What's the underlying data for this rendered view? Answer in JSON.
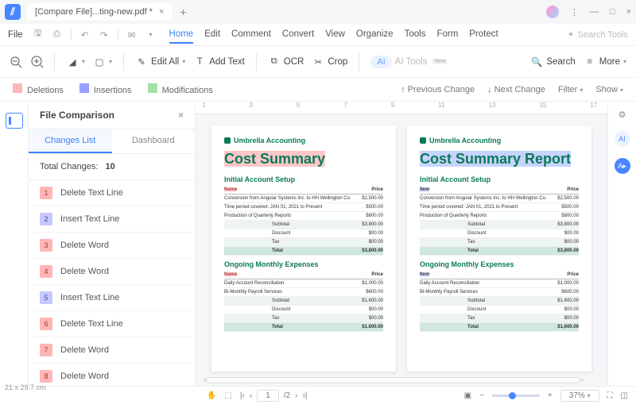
{
  "title": {
    "tab": "[Compare  File]...ting-new.pdf *"
  },
  "menu": {
    "file": "File",
    "tabs": [
      "Home",
      "Edit",
      "Comment",
      "Convert",
      "View",
      "Organize",
      "Tools",
      "Form",
      "Protect"
    ],
    "search_tools": "Search Tools"
  },
  "toolbar": {
    "edit_all": "Edit All",
    "add_text": "Add Text",
    "ocr": "OCR",
    "crop": "Crop",
    "ai_tools": "AI Tools",
    "new": "New",
    "search": "Search",
    "more": "More"
  },
  "legend": {
    "deletions": "Deletions",
    "insertions": "Insertions",
    "modifications": "Modifications",
    "prev": "Previous Change",
    "next": "Next Change",
    "filter": "Filter",
    "show": "Show"
  },
  "sidebar": {
    "title": "File Comparison",
    "tab_changes": "Changes List",
    "tab_dashboard": "Dashboard",
    "total_label": "Total Changes:",
    "total": "10",
    "items": [
      {
        "n": "1",
        "label": "Delete Text Line",
        "kind": "del"
      },
      {
        "n": "2",
        "label": "Insert Text Line",
        "kind": "ins"
      },
      {
        "n": "3",
        "label": "Delete Word",
        "kind": "del"
      },
      {
        "n": "4",
        "label": "Delete Word",
        "kind": "del"
      },
      {
        "n": "5",
        "label": "Insert Text Line",
        "kind": "ins"
      },
      {
        "n": "6",
        "label": "Delete Text Line",
        "kind": "del"
      },
      {
        "n": "7",
        "label": "Delete Word",
        "kind": "del"
      },
      {
        "n": "8",
        "label": "Delete Word",
        "kind": "del"
      }
    ]
  },
  "doc": {
    "brand": "Umbrella Accounting",
    "left_title": "Cost Summary",
    "right_title": "Cost Summary Report",
    "sec1": "Initial Account Setup",
    "sec2": "Ongoing Monthly Expenses",
    "col_name": "Name",
    "col_item": "Item",
    "col_price": "Price",
    "rows1": [
      {
        "d": "Conversion from Angular Systems Inc. to HH Wellington Co.",
        "p": "$2,500.00"
      },
      {
        "d": "Time period covered: JAN 01, 2021 to Present",
        "p": "$500.00"
      },
      {
        "d": "Production of Quarterly Reports",
        "p": "$800.00"
      }
    ],
    "sub1": [
      {
        "l": "Subtotal",
        "p": "$3,800.00"
      },
      {
        "l": "Discount",
        "p": "$00.00"
      },
      {
        "l": "Tax",
        "p": "$00.00"
      },
      {
        "l": "Total",
        "p": "$3,800.00"
      }
    ],
    "rows2": [
      {
        "d": "Daily Account Reconciliation",
        "p": "$1,000.00"
      },
      {
        "d": "Bi-Monthly Payroll Services",
        "p": "$600.00"
      }
    ],
    "sub2": [
      {
        "l": "Subtotal",
        "p": "$1,600.00"
      },
      {
        "l": "Discount",
        "p": "$00.00"
      },
      {
        "l": "Tax",
        "p": "$00.00"
      },
      {
        "l": "Total",
        "p": "$1,600.00"
      }
    ]
  },
  "status": {
    "dim": "21 x 29.7 cm",
    "page": "1",
    "pages": "/2",
    "zoom": "37%"
  }
}
